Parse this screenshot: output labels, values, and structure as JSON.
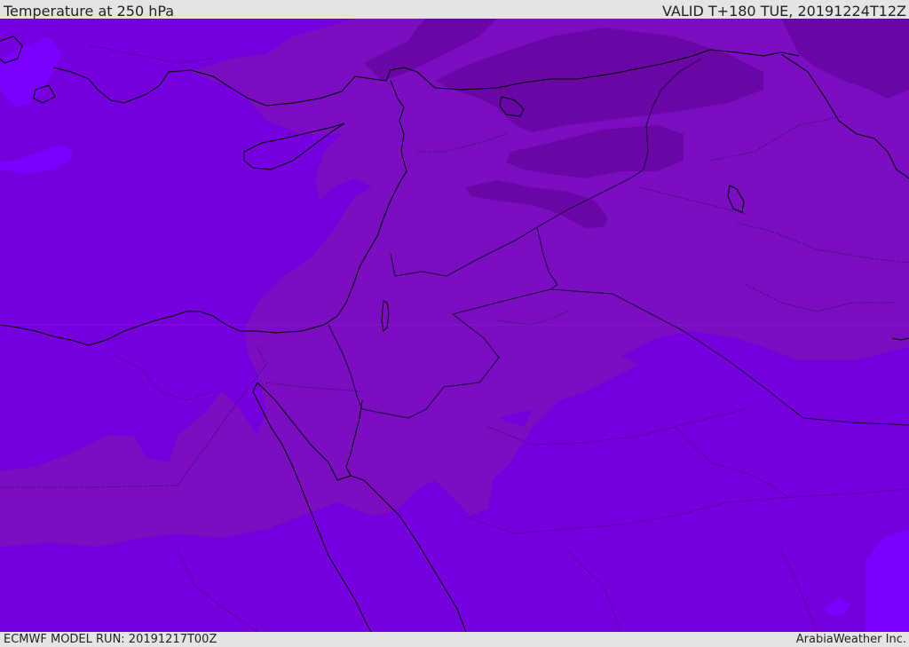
{
  "header": {
    "title": "Temperature at 250 hPa",
    "valid": "VALID T+180 TUE, 20191224T12Z"
  },
  "footer": {
    "model_run": "ECMWF MODEL RUN: 20191217T00Z",
    "credit": "ArabiaWeather Inc."
  },
  "map": {
    "field": "temperature",
    "level": "250 hPa",
    "colors": {
      "base": "#7600dd",
      "cooler": "#7a0ec0",
      "coldest": "#6a06a5",
      "warm": "#7a00ff",
      "coastline": "#000000",
      "borders": "#2a0060"
    }
  }
}
